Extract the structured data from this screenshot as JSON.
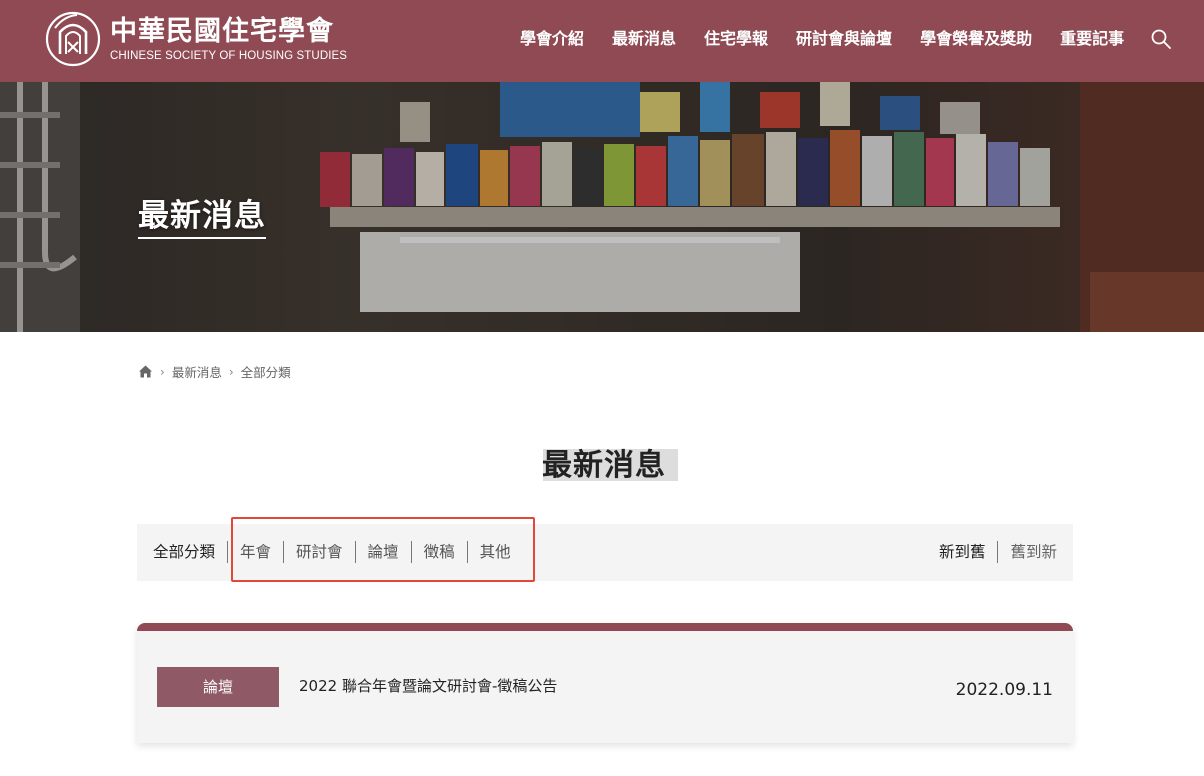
{
  "header": {
    "logo_cn": "中華民國住宅學會",
    "logo_en": "CHINESE SOCIETY OF HOUSING STUDIES",
    "brand_color": "#8f4a54",
    "nav": [
      {
        "label": "學會介紹"
      },
      {
        "label": "最新消息"
      },
      {
        "label": "住宅學報"
      },
      {
        "label": "研討會與論壇"
      },
      {
        "label": "學會榮譽及獎助"
      },
      {
        "label": "重要記事"
      }
    ],
    "search_icon": "search-icon"
  },
  "banner": {
    "title": "最新消息"
  },
  "breadcrumb": {
    "home_icon": "home-icon",
    "items": [
      {
        "label": "最新消息"
      },
      {
        "label": "全部分類"
      }
    ]
  },
  "main": {
    "title": "最新消息",
    "filters": [
      {
        "label": "全部分類"
      },
      {
        "label": "年會"
      },
      {
        "label": "研討會"
      },
      {
        "label": "論壇"
      },
      {
        "label": "徵稿"
      },
      {
        "label": "其他"
      }
    ],
    "sort": [
      {
        "label": "新到舊"
      },
      {
        "label": "舊到新"
      }
    ],
    "highlight_color": "#e2473a"
  },
  "news": [
    {
      "category": "論壇",
      "title": "2022 聯合年會暨論文研討會-徵稿公告",
      "date": "2022.09.11"
    }
  ]
}
